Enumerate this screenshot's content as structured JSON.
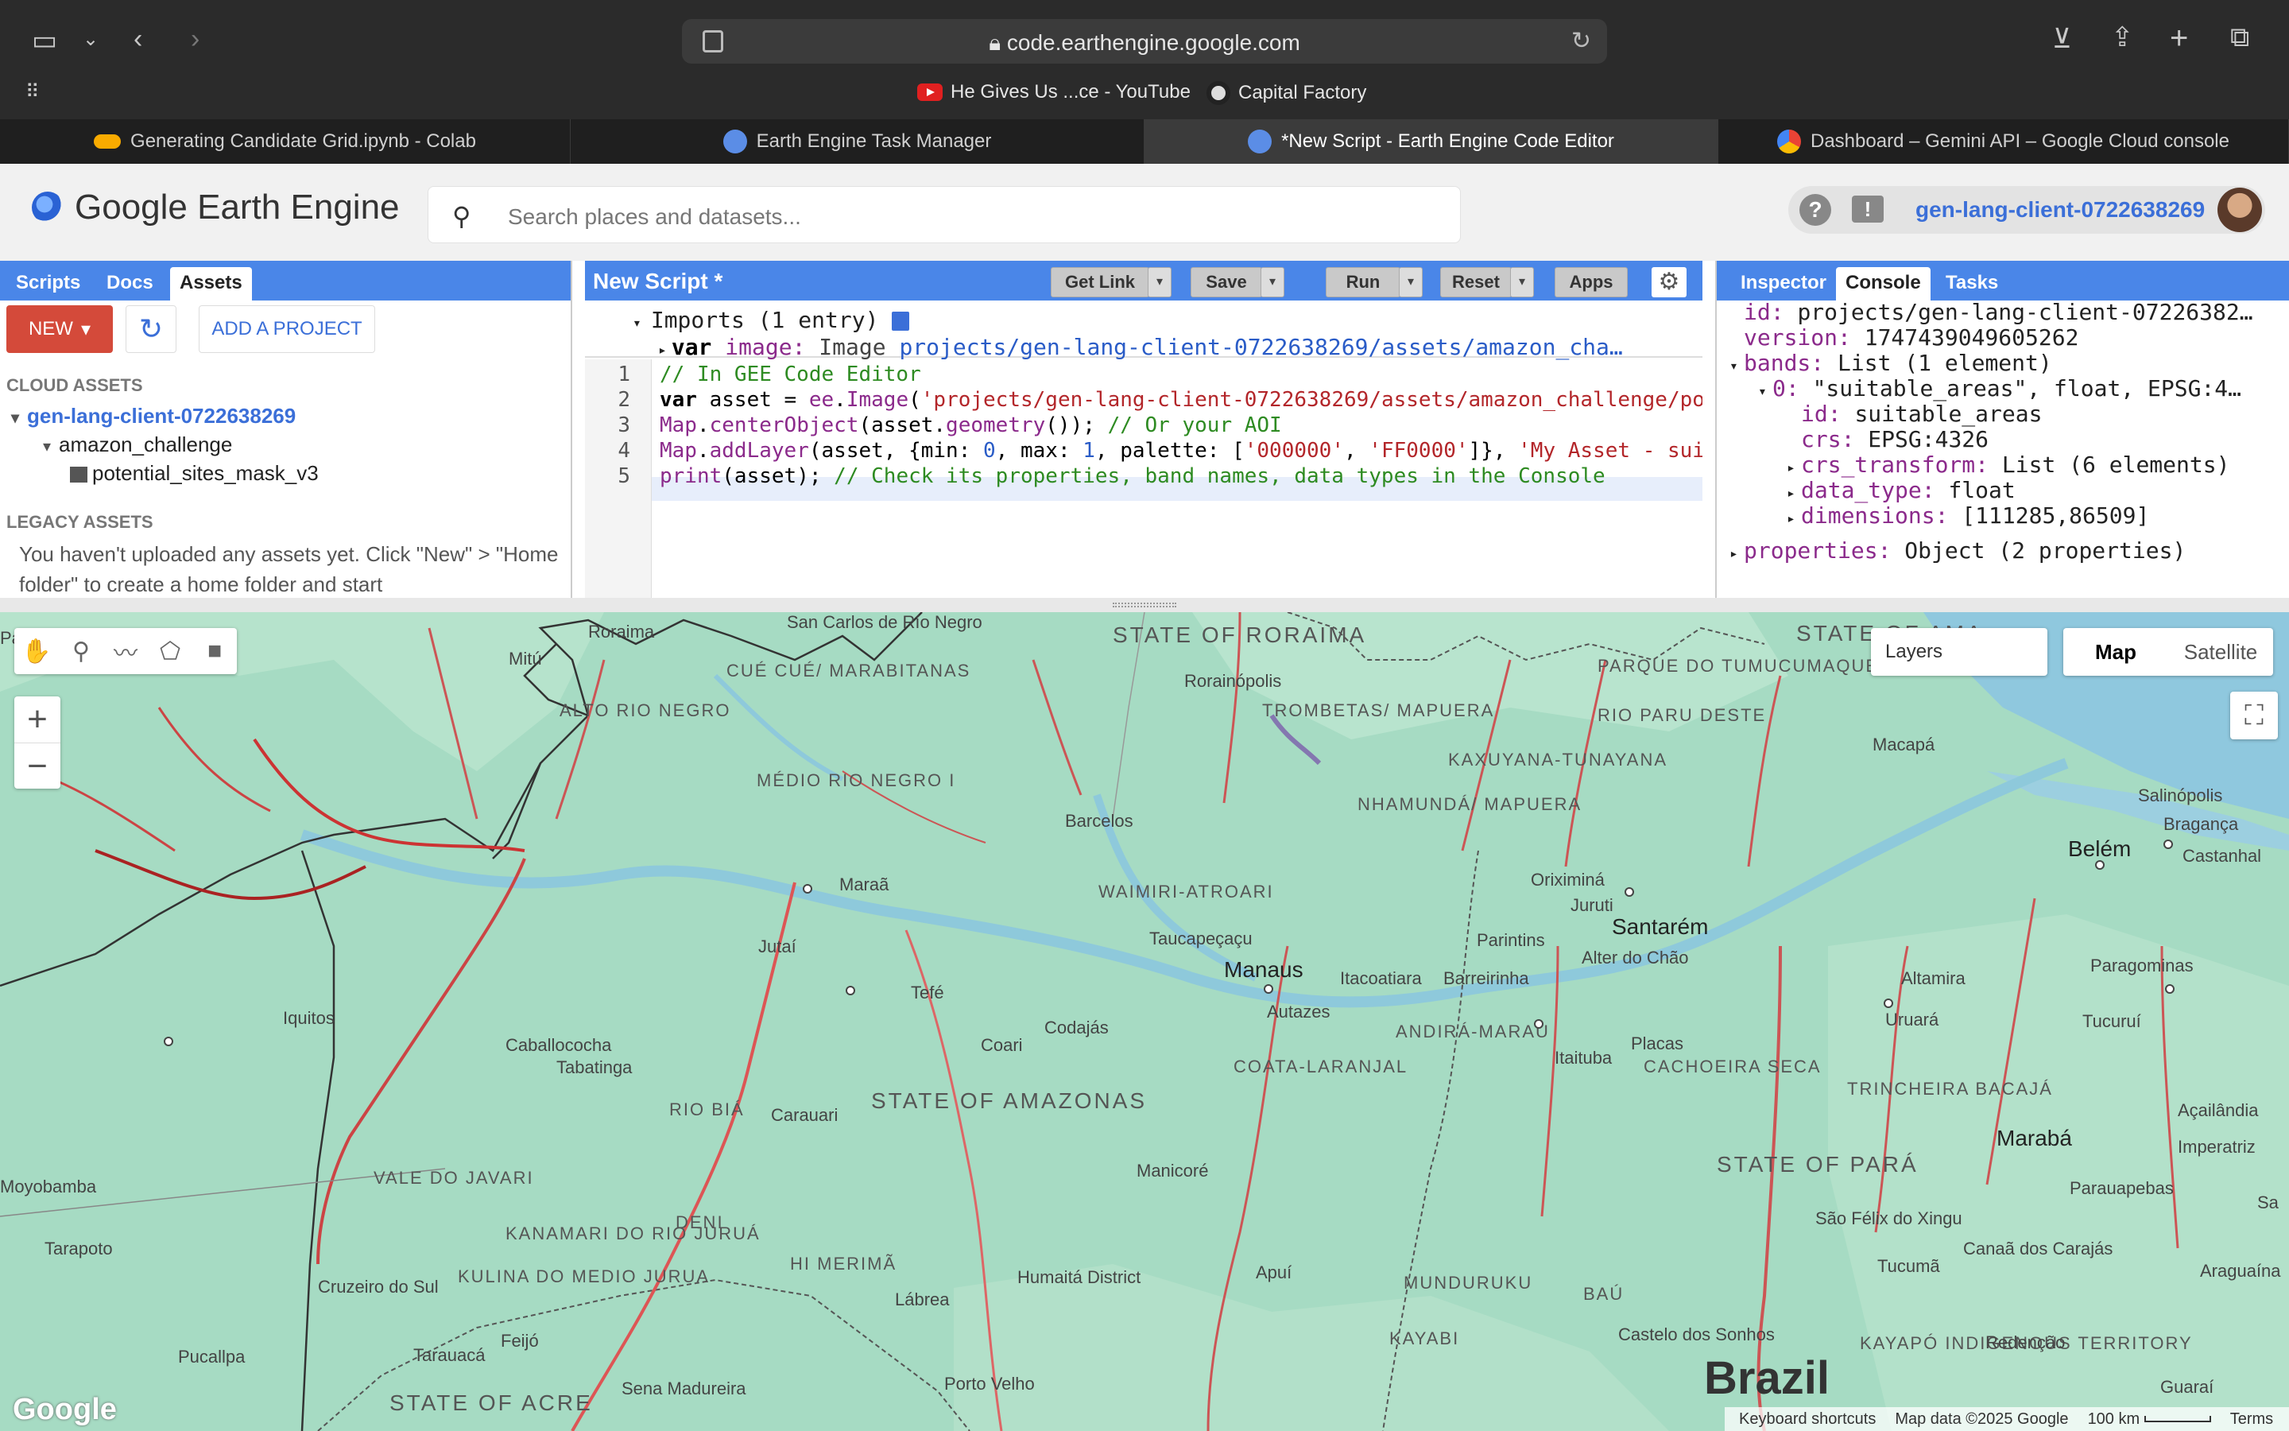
{
  "browser": {
    "url": "code.earthengine.google.com",
    "bookmarks": [
      "He Gives Us ...ce - YouTube",
      "Capital Factory"
    ],
    "tabs": [
      {
        "label": "Generating Candidate Grid.ipynb - Colab",
        "active": false
      },
      {
        "label": "Earth Engine Task Manager",
        "active": false
      },
      {
        "label": "*New Script - Earth Engine Code Editor",
        "active": true
      },
      {
        "label": "Dashboard – Gemini API – Google Cloud console",
        "active": false
      }
    ]
  },
  "header": {
    "app_title": "Google Earth Engine",
    "search_placeholder": "Search places and datasets...",
    "project": "gen-lang-client-0722638269"
  },
  "left_panel": {
    "tabs": [
      "Scripts",
      "Docs",
      "Assets"
    ],
    "active_tab": "Assets",
    "new_label": "NEW",
    "add_project_label": "ADD A PROJECT",
    "cloud_assets_title": "CLOUD ASSETS",
    "project": "gen-lang-client-0722638269",
    "folder": "amazon_challenge",
    "asset": "potential_sites_mask_v3",
    "legacy_title": "LEGACY ASSETS",
    "legacy_message": "You haven't uploaded any assets yet. Click \"New\" > \"Home folder\" to create a home folder and start"
  },
  "editor": {
    "title": "New Script *",
    "buttons": {
      "get_link": "Get Link",
      "save": "Save",
      "run": "Run",
      "reset": "Reset",
      "apps": "Apps"
    },
    "imports_header": "Imports (1 entry)",
    "import_var": "var",
    "import_name": "image:",
    "import_type": "Image",
    "import_value": "projects/gen-lang-client-0722638269/assets/amazon_cha…",
    "line_numbers": [
      "1",
      "2",
      "3",
      "4",
      "5"
    ],
    "lines": [
      [
        {
          "t": "// In GEE Code Editor",
          "c": "cm"
        }
      ],
      [
        {
          "t": "var",
          "c": "kw"
        },
        {
          "t": " asset = ",
          "c": ""
        },
        {
          "t": "ee",
          "c": "obj"
        },
        {
          "t": ".",
          "c": ""
        },
        {
          "t": "Image",
          "c": "obj"
        },
        {
          "t": "(",
          "c": ""
        },
        {
          "t": "'projects/gen-lang-client-0722638269/assets/amazon_challenge/po",
          "c": "str"
        }
      ],
      [
        {
          "t": "Map",
          "c": "obj"
        },
        {
          "t": ".",
          "c": ""
        },
        {
          "t": "centerObject",
          "c": "obj"
        },
        {
          "t": "(asset.",
          "c": ""
        },
        {
          "t": "geometry",
          "c": "obj"
        },
        {
          "t": "()); ",
          "c": ""
        },
        {
          "t": "// Or your AOI",
          "c": "cm"
        }
      ],
      [
        {
          "t": "Map",
          "c": "obj"
        },
        {
          "t": ".",
          "c": ""
        },
        {
          "t": "addLayer",
          "c": "obj"
        },
        {
          "t": "(asset, {min: ",
          "c": ""
        },
        {
          "t": "0",
          "c": "num"
        },
        {
          "t": ", max: ",
          "c": ""
        },
        {
          "t": "1",
          "c": "num"
        },
        {
          "t": ", palette: [",
          "c": ""
        },
        {
          "t": "'000000'",
          "c": "str"
        },
        {
          "t": ", ",
          "c": ""
        },
        {
          "t": "'FF0000'",
          "c": "str"
        },
        {
          "t": "]}, ",
          "c": ""
        },
        {
          "t": "'My Asset - sui",
          "c": "str"
        }
      ],
      [
        {
          "t": "print",
          "c": "obj"
        },
        {
          "t": "(asset); ",
          "c": ""
        },
        {
          "t": "// Check its properties, band names, data types in the Console",
          "c": "cm"
        }
      ]
    ]
  },
  "right_panel": {
    "tabs": [
      "Inspector",
      "Console",
      "Tasks"
    ],
    "active_tab": "Console",
    "console": [
      {
        "indent": 0,
        "caret": "",
        "key": "id:",
        "value": "projects/gen-lang-client-07226382…"
      },
      {
        "indent": 0,
        "caret": "",
        "key": "version:",
        "value": "1747439049605262"
      },
      {
        "indent": 0,
        "caret": "▾",
        "key": "bands:",
        "value": "List (1 element)"
      },
      {
        "indent": 1,
        "caret": "▾",
        "key": "0:",
        "value": "\"suitable_areas\", float, EPSG:4…"
      },
      {
        "indent": 2,
        "caret": "",
        "key": "id:",
        "value": "suitable_areas"
      },
      {
        "indent": 2,
        "caret": "",
        "key": "crs:",
        "value": "EPSG:4326"
      },
      {
        "indent": 2,
        "caret": "▸",
        "key": "crs_transform:",
        "value": "List (6 elements)"
      },
      {
        "indent": 2,
        "caret": "▸",
        "key": "data_type:",
        "value": "float"
      },
      {
        "indent": 2,
        "caret": "▸",
        "key": "dimensions:",
        "value": "[111285,86509]"
      },
      {
        "indent": 0,
        "caret": "▸",
        "key": "properties:",
        "value": "Object (2 properties)"
      }
    ]
  },
  "map": {
    "layers_label": "Layers",
    "map_type": [
      "Map",
      "Satellite"
    ],
    "active_type": "Map",
    "google": "Google",
    "attribution": [
      "Keyboard shortcuts",
      "Map data ©2025 Google",
      "100 km",
      "Terms"
    ],
    "country": "Brazil",
    "states": [
      "STATE OF RORAIMA",
      "STATE OF AMAZONAS",
      "STATE OF PARÁ",
      "STATE OF ACRE",
      "STATE OF AMA"
    ],
    "regions": [
      "CUÉ CUÉ/ MARABITANAS",
      "ALTO RIO NEGRO",
      "MÉDIO RIO NEGRO I",
      "TROMBETAS/ MAPUERA",
      "PARQUE DO TUMUCUMAQUE",
      "RIO PARU DESTE",
      "KAXUYANA-TUNAYANA",
      "NHAMUNDÁ/ MAPUERA",
      "WAIMIRI-ATROARI",
      "COATA-LARANJAL",
      "ANDIRÁ-MARAU",
      "CACHOEIRA SECA",
      "TRINCHEIRA BACAJÁ",
      "RIO BIÁ",
      "VALE DO JAVARI",
      "KANAMARI DO RIO JURUÁ",
      "DENI",
      "KULINA DO MEDIO JURUA",
      "HI MERIMÃ",
      "MUNDURUKU",
      "KAYABI",
      "BAÚ",
      "KAYAPÓ INDIGENOUS TERRITORY"
    ],
    "cities": [
      "San Carlos de Río Negro",
      "Mitú",
      "Roraima",
      "Rorainópolis",
      "Macapá",
      "Salinópolis",
      "Belém",
      "Bragança",
      "Castanhal",
      "Barcelos",
      "Maraã",
      "Oriximiná",
      "Juruti",
      "Santarém",
      "Alter do Chão",
      "Paragominas",
      "Tefé",
      "Jutaí",
      "Taucapeçaçu",
      "Manaus",
      "Itacoatiara",
      "Parintins",
      "Barreirinha",
      "Altamira",
      "Iquitos",
      "Caballococha",
      "Tabatinga",
      "Codajás",
      "Autazes",
      "Coari",
      "Uruará",
      "Tucuruí",
      "Placas",
      "Itaituba",
      "Carauari",
      "Marabá",
      "Açailândia",
      "Imperatriz",
      "Moyobamba",
      "Manicoré",
      "Parauapebas",
      "Tarapoto",
      "São Félix do Xingu",
      "Canaã dos Carajás",
      "Tucumã",
      "Araguaína",
      "Cruzeiro do Sul",
      "Lábrea",
      "Humaitá District",
      "Apuí",
      "Pucallpa",
      "Tarauacá",
      "Feijó",
      "Sena Madureira",
      "Porto Velho",
      "Castelo dos Sonhos",
      "Redenção",
      "Guaraí",
      "Pa",
      "Sa"
    ]
  }
}
